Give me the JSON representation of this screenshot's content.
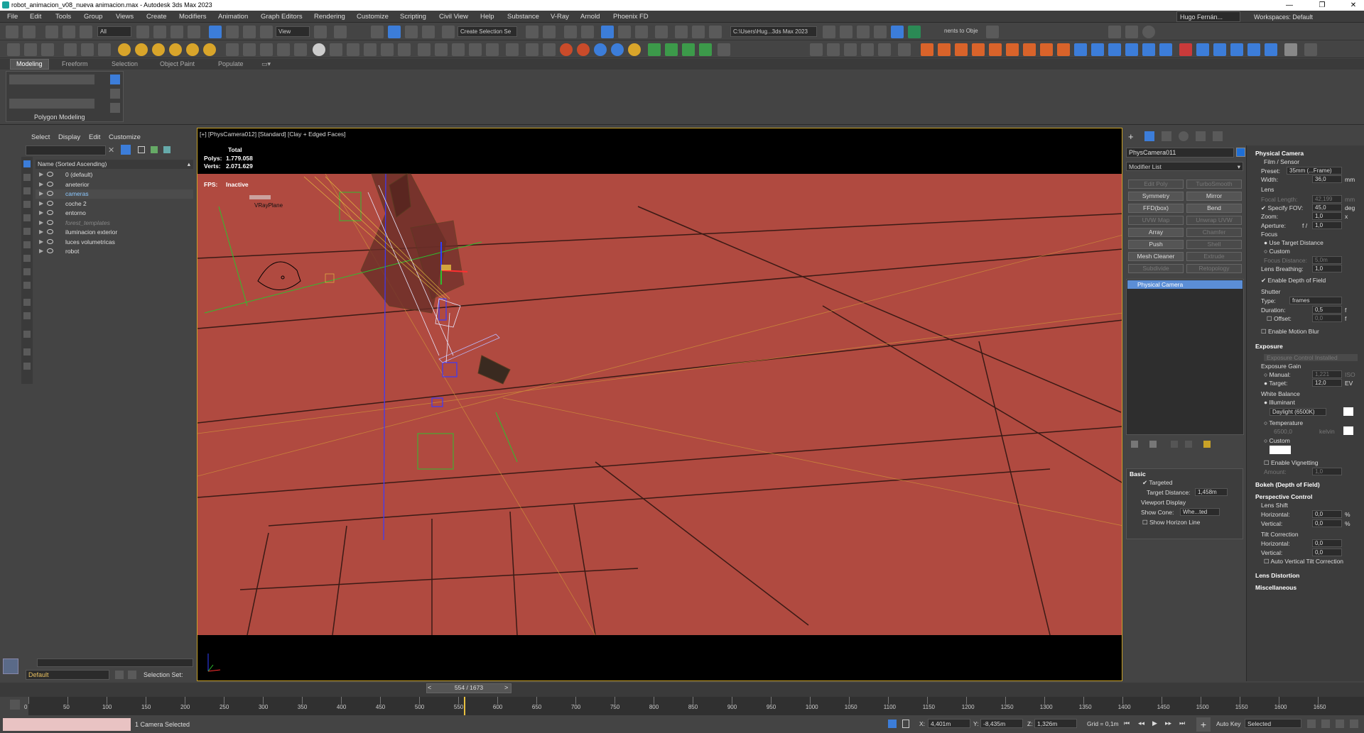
{
  "titlebar": {
    "title": "robot_animacion_v08_nueva animacion.max - Autodesk 3ds Max 2023",
    "minimize": "—",
    "restore": "❐",
    "close": "✕"
  },
  "menu": [
    "File",
    "Edit",
    "Tools",
    "Group",
    "Views",
    "Create",
    "Modifiers",
    "Animation",
    "Graph Editors",
    "Rendering",
    "Customize",
    "Scripting",
    "Civil View",
    "Help",
    "Substance",
    "V-Ray",
    "Arnold",
    "Phoenix FD"
  ],
  "user": "Hugo Fernán...",
  "workspace": "Workspaces: Default",
  "toolbar": {
    "selection_filter": "All",
    "ref_coord": "View",
    "named_sel": "Create Selection Se",
    "path": "C:\\Users\\Hug...3ds Max 2023",
    "snap_target": "nents to Obje"
  },
  "ribbon": {
    "tabs": [
      "Modeling",
      "Freeform",
      "Selection",
      "Object Paint",
      "Populate"
    ],
    "panel_label": "Polygon Modeling"
  },
  "scene_explorer": {
    "menu": [
      "Select",
      "Display",
      "Edit",
      "Customize"
    ],
    "header": "Name (Sorted Ascending)",
    "items": [
      {
        "name": "0 (default)"
      },
      {
        "name": "aneterior"
      },
      {
        "name": "cameras",
        "selected": true
      },
      {
        "name": "coche 2"
      },
      {
        "name": "entorno"
      },
      {
        "name": "forest_templates",
        "dim": true
      },
      {
        "name": "iluminacion exterior"
      },
      {
        "name": "luces volumetricas"
      },
      {
        "name": "robot"
      }
    ],
    "layer": "Default",
    "selection_set_label": "Selection Set:"
  },
  "viewport": {
    "label": "[+] [PhysCamera012] [Standard] [Clay + Edged Faces]",
    "stats_total": "Total",
    "polys_label": "Polys:",
    "polys_value": "1.779.058",
    "verts_label": "Verts:",
    "verts_value": "2.071.629",
    "fps_label": "FPS:",
    "fps_value": "Inactive",
    "vrayplane_label": "VRayPlane",
    "ground_color": "#b04a40"
  },
  "command_panel": {
    "object_name": "PhysCamera011",
    "object_color": "#1f6fd6",
    "modifier_list": "Modifier List",
    "buttons": [
      {
        "label": "Edit Poly",
        "enabled": false
      },
      {
        "label": "TurboSmooth",
        "enabled": false
      },
      {
        "label": "Symmetry",
        "enabled": true
      },
      {
        "label": "Mirror",
        "enabled": true
      },
      {
        "label": "FFD(box)",
        "enabled": true
      },
      {
        "label": "Bend",
        "enabled": true
      },
      {
        "label": "UVW Map",
        "enabled": false
      },
      {
        "label": "Unwrap UVW",
        "enabled": false
      },
      {
        "label": "Array",
        "enabled": true
      },
      {
        "label": "Chamfer",
        "enabled": false
      },
      {
        "label": "Push",
        "enabled": true
      },
      {
        "label": "Shell",
        "enabled": false
      },
      {
        "label": "Mesh Cleaner",
        "enabled": true
      },
      {
        "label": "Extrude",
        "enabled": false
      },
      {
        "label": "Subdivide",
        "enabled": false
      },
      {
        "label": "Retopology",
        "enabled": false
      }
    ],
    "stack_item": "Physical Camera",
    "basic": {
      "title": "Basic",
      "targeted": "Targeted",
      "target_distance_label": "Target Distance:",
      "target_distance": "1,458m",
      "viewport_display": "Viewport Display",
      "show_cone_label": "Show Cone:",
      "show_cone": "Whe...ted",
      "show_horizon": "Show Horizon Line"
    }
  },
  "physical_camera": {
    "title": "Physical Camera",
    "film_sensor": "Film / Sensor",
    "preset_label": "Preset:",
    "preset": "35mm (...Frame)",
    "width_label": "Width:",
    "width": "36,0",
    "width_unit": "mm",
    "lens": "Lens",
    "focal_length_label": "Focal Length:",
    "focal_length": "42,199",
    "focal_unit": "mm",
    "specify_fov": "Specify FOV:",
    "fov": "45,0",
    "fov_unit": "deg",
    "zoom_label": "Zoom:",
    "zoom": "1,0",
    "zoom_unit": "x",
    "aperture_label": "Aperture:",
    "aperture_prefix": "f /",
    "aperture": "1,0",
    "focus": "Focus",
    "use_target_distance": "Use Target Distance",
    "custom": "Custom",
    "focus_distance_label": "Focus Distance:",
    "focus_distance": "5,0m",
    "lens_breathing_label": "Lens Breathing:",
    "lens_breathing": "1,0",
    "enable_dof": "Enable Depth of Field",
    "shutter": "Shutter",
    "type_label": "Type:",
    "type": "frames",
    "duration_label": "Duration:",
    "duration": "0,5",
    "duration_unit": "f",
    "offset_label": "Offset:",
    "offset": "0,0",
    "offset_unit": "f",
    "enable_motion_blur": "Enable Motion Blur",
    "exposure_title": "Exposure",
    "exposure_control_installed": "Exposure Control Installed",
    "exposure_gain": "Exposure Gain",
    "manual_label": "Manual:",
    "manual": "1,221",
    "manual_unit": "ISO",
    "target_label": "Target:",
    "target": "12,0",
    "target_unit": "EV",
    "white_balance": "White Balance",
    "illuminant": "Illuminant",
    "illuminant_value": "Daylight (6500K)",
    "temperature": "Temperature",
    "temperature_value": "6500,0",
    "temperature_unit": "kelvin",
    "custom_wb": "Custom",
    "enable_vignetting": "Enable Vignetting",
    "amount_label": "Amount:",
    "amount": "1,0",
    "bokeh": "Bokeh (Depth of Field)",
    "perspective_control": "Perspective Control",
    "lens_shift": "Lens Shift",
    "horizontal_label": "Horizontal:",
    "horizontal": "0,0",
    "vertical_label": "Vertical:",
    "vertical": "0,0",
    "percent": "%",
    "tilt_correction": "Tilt Correction",
    "tilt_horizontal": "0,0",
    "tilt_vertical": "0,0",
    "auto_vertical": "Auto Vertical Tilt Correction",
    "lens_distortion": "Lens Distortion",
    "miscellaneous": "Miscellaneous"
  },
  "timeline": {
    "slider": "554 / 1673",
    "ticks": [
      0,
      50,
      100,
      150,
      200,
      250,
      300,
      350,
      400,
      450,
      500,
      550,
      600,
      650,
      700,
      750,
      800,
      850,
      900,
      950,
      1000,
      1050,
      1100,
      1150,
      1200,
      1250,
      1300,
      1350,
      1400,
      1450,
      1500,
      1550,
      1600,
      1650
    ]
  },
  "status": {
    "selected": "1 Camera Selected",
    "x_label": "X:",
    "x": "4,401m",
    "y_label": "Y:",
    "y": "-8,435m",
    "z_label": "Z:",
    "z": "1,326m",
    "grid": "Grid = 0,1m",
    "auto_key": "Auto Key",
    "selected_dd": "Selected"
  }
}
